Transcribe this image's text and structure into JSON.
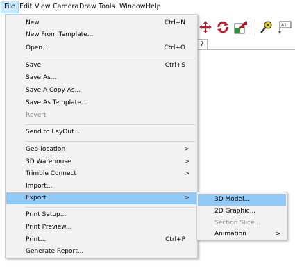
{
  "menubar": {
    "items": [
      "File",
      "Edit",
      "View",
      "Camera",
      "Draw",
      "Tools",
      "Window",
      "Help"
    ]
  },
  "toolbar": {
    "icons": [
      "move-icon",
      "rotate-icon",
      "scale-icon",
      "tape-measure-icon",
      "text-label-icon"
    ],
    "text_icon_label": "A1"
  },
  "tabstrip": {
    "tab_label": "7"
  },
  "file_menu": {
    "items": [
      {
        "label": "New",
        "shortcut": "Ctrl+N"
      },
      {
        "label": "New From Template...",
        "shortcut": ""
      },
      {
        "label": "Open...",
        "shortcut": "Ctrl+O"
      },
      {
        "label": "Save",
        "shortcut": "Ctrl+S"
      },
      {
        "label": "Save As...",
        "shortcut": ""
      },
      {
        "label": "Save A Copy As...",
        "shortcut": ""
      },
      {
        "label": "Save As Template...",
        "shortcut": ""
      },
      {
        "label": "Revert",
        "shortcut": "",
        "disabled": true
      },
      {
        "label": "Send to LayOut...",
        "shortcut": ""
      },
      {
        "label": "Geo-location",
        "submenu": true
      },
      {
        "label": "3D Warehouse",
        "submenu": true
      },
      {
        "label": "Trimble Connect",
        "submenu": true
      },
      {
        "label": "Import...",
        "shortcut": ""
      },
      {
        "label": "Export",
        "submenu": true,
        "highlighted": true
      },
      {
        "label": "Print Setup...",
        "shortcut": ""
      },
      {
        "label": "Print Preview...",
        "shortcut": ""
      },
      {
        "label": "Print...",
        "shortcut": "Ctrl+P"
      },
      {
        "label": "Generate Report...",
        "shortcut": ""
      }
    ],
    "arrow_glyph": ">"
  },
  "export_submenu": {
    "items": [
      {
        "label": "3D Model...",
        "highlighted": true
      },
      {
        "label": "2D Graphic..."
      },
      {
        "label": "Section Slice...",
        "disabled": true
      },
      {
        "label": "Animation",
        "submenu": true
      }
    ]
  },
  "colors": {
    "menu_bg": "#f2f2f2",
    "highlight": "#91c9f7",
    "menubar_active": "#cce8ff",
    "disabled_text": "#8c8c8c"
  }
}
